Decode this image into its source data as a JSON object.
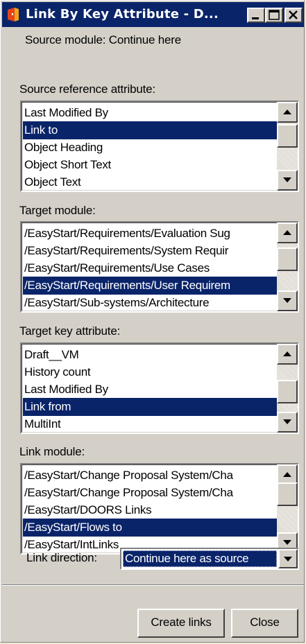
{
  "window": {
    "title": "Link By Key Attribute - D...",
    "title_bar_color": "#0a246a",
    "face_color": "#d4d0c8"
  },
  "source_module_text": "Source module: Continue here",
  "source_ref": {
    "label": "Source reference attribute:",
    "items": [
      "Last Modified By",
      "Link to",
      "Object Heading",
      "Object Short Text",
      "Object Text"
    ],
    "selected": "Link to"
  },
  "target_module": {
    "label": "Target module:",
    "items": [
      "/EasyStart/Requirements/Evaluation Sug",
      "/EasyStart/Requirements/System Requir",
      "/EasyStart/Requirements/Use Cases",
      "/EasyStart/Requirements/User Requirem",
      "/EasyStart/Sub-systems/Architecture"
    ],
    "selected": "/EasyStart/Requirements/User Requirem"
  },
  "target_key": {
    "label": "Target key attribute:",
    "items": [
      "Draft__VM",
      "History count",
      "Last Modified By",
      "Link from",
      "MultiInt"
    ],
    "selected": "Link from"
  },
  "link_module": {
    "label": "Link module:",
    "items": [
      "/EasyStart/Change Proposal System/Cha",
      "/EasyStart/Change Proposal System/Cha",
      "/EasyStart/DOORS Links",
      "/EasyStart/Flows to",
      "/EasyStart/IntLinks"
    ],
    "selected": "/EasyStart/Flows to"
  },
  "link_direction": {
    "label": "Link direction:",
    "value": "Continue here as source"
  },
  "buttons": {
    "create": "Create links",
    "close": "Close"
  },
  "icons": {
    "app": "doors-app-icon",
    "minimize": "minimize-icon",
    "maximize": "maximize-icon",
    "close": "close-icon"
  }
}
